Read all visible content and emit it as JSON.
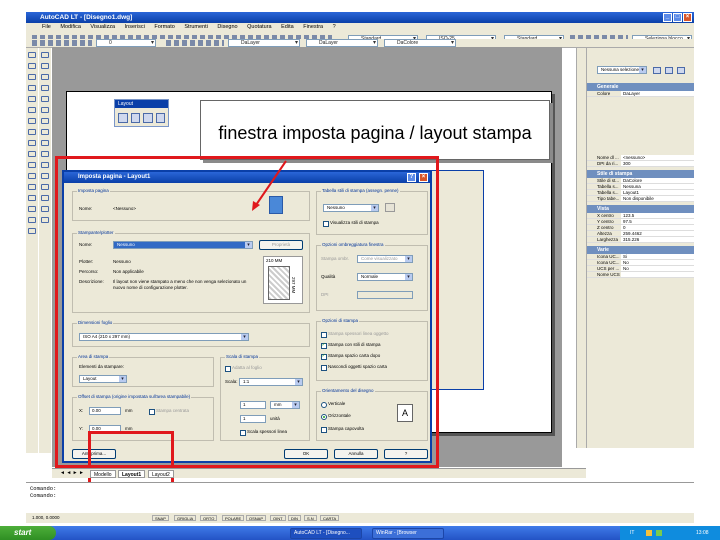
{
  "window": {
    "title": "AutoCAD LT - [Disegno1.dwg]",
    "menu": [
      "File",
      "Modifica",
      "Visualizza",
      "Inserisci",
      "Formato",
      "Strumenti",
      "Disegno",
      "Quotatura",
      "Edita",
      "Finestra",
      "?"
    ],
    "combos": {
      "layer": "0",
      "linetype1": "DaLayer",
      "linetype2": "DaLayer",
      "color": "DaColore",
      "textstyle": "Standard",
      "dimstyle": "ISO-25",
      "plotstyle": "Standard",
      "select_block": "Seleziona blocco"
    }
  },
  "layout_toolbar": {
    "title": "Layout"
  },
  "annotation": {
    "callout": "finestra imposta pagina / layout stampa"
  },
  "palette": {
    "top_combo": "Nessuna selezione",
    "sections": [
      {
        "title": "Generale",
        "rows": [
          [
            "Colore",
            "DaLayer"
          ]
        ]
      },
      {
        "title": "",
        "rows": [
          [
            "Nome dl ...",
            "<nessuno>"
          ],
          [
            "DPI da ri...",
            "300"
          ]
        ]
      },
      {
        "title": "Stile di stampa",
        "rows": [
          [
            "Stile di st...",
            "DaColore"
          ],
          [
            "Tabella s...",
            "Nessuna"
          ],
          [
            "Tabella s...",
            "Layout1"
          ],
          [
            "Tipo tabe...",
            "Non disponibile"
          ]
        ]
      },
      {
        "title": "Vista",
        "rows": [
          [
            "X centro",
            "123.5"
          ],
          [
            "Y centro",
            "97.5"
          ],
          [
            "Z centro",
            "0"
          ],
          [
            "Altezza",
            "259.4462"
          ],
          [
            "Larghezza",
            "315.226"
          ]
        ]
      },
      {
        "title": "Varie",
        "rows": [
          [
            "Icona UC...",
            "Si"
          ],
          [
            "Icona UC...",
            "No"
          ],
          [
            "UCS per ...",
            "No"
          ],
          [
            "Nome UCS",
            ""
          ]
        ]
      }
    ]
  },
  "dialog": {
    "title": "Imposta pagina - Layout1",
    "page_setup": {
      "label": "Imposta pagina",
      "name_label": "Nome:",
      "name_value": "<Nessuno>"
    },
    "plotter": {
      "label": "Stampante/plotter",
      "name_label": "Nome:",
      "name_value": "Nessuno",
      "properties_button": "Proprietà",
      "plotter_label": "Plotter:",
      "plotter_value": "Nessuno",
      "path_label": "Percorso:",
      "path_value": "Non applicabile",
      "desc_label": "Descrizione:",
      "desc_value": "Il layout non viene stampato a meno che non venga selezionato un nuovo nome di configurazione plotter.",
      "preview_w": "210 MM",
      "preview_h": "297 MM"
    },
    "paper_size": {
      "label": "Dimensioni foglio",
      "value": "ISO A4 (210 x 297 mm)"
    },
    "plot_area": {
      "label": "Area di stampa",
      "what_label": "Elementi da stampare:",
      "what_value": "Layout"
    },
    "plot_scale": {
      "label": "Scala di stampa",
      "fit": "Adatta al foglio",
      "scale_label": "Scala:",
      "scale_value": "1:1",
      "num": "1",
      "unit": "mm",
      "den": "1",
      "den_unit": "unità",
      "lineweights": "Scala spessori linea"
    },
    "offset": {
      "label": "Offset di stampa (origine impostata sull'area stampabile)",
      "x_label": "X:",
      "x_value": "0.00",
      "x_unit": "mm",
      "center": "Stampa centrata",
      "y_label": "Y:",
      "y_value": "0.00",
      "y_unit": "mm"
    },
    "plot_style_table": {
      "label": "Tabella stili di stampa (assegn. penne)",
      "value": "Nessuno",
      "display": "Visualizza stili di stampa"
    },
    "shaded_viewport": {
      "label": "Opzioni ombreggiatura finestra",
      "shade_label": "Stampa ombr.",
      "shade_value": "Come visualizzato",
      "quality_label": "Qualità",
      "quality_value": "Normale",
      "dpi_label": "DPI"
    },
    "plot_options": {
      "label": "Opzioni di stampa",
      "items": [
        {
          "text": "Stampa spessori linea oggetto",
          "checked": false
        },
        {
          "text": "Stampa con stili di stampa",
          "checked": true
        },
        {
          "text": "Stampa spazio carta dopo",
          "checked": true
        },
        {
          "text": "Nascondi oggetti spazio carta",
          "checked": false
        }
      ]
    },
    "orientation": {
      "label": "Orientamento del disegno",
      "portrait": "Verticale",
      "landscape": "Orizzontale",
      "upside": "Stampa capovolta"
    },
    "buttons": {
      "preview": "Anteprima...",
      "ok": "OK",
      "cancel": "Annulla",
      "help": "?"
    }
  },
  "tabs": [
    "Modello",
    "Layout1",
    "Layout2"
  ],
  "command_line": [
    "Comando:",
    "Comando:"
  ],
  "status_bar": {
    "coords": "1.000, 0.0000",
    "buttons": [
      "SNAP",
      "GRIGLIA",
      "ORTO",
      "POLARE",
      "OSNAP",
      "OINT",
      "DIN",
      "S.N",
      "CARTA"
    ]
  },
  "taskbar": {
    "start": "start",
    "tasks": [
      "AutoCAD LT - [Disegno...",
      "WinRar - [Browser"
    ],
    "tray_lang": "IT",
    "clock": "13:08"
  }
}
